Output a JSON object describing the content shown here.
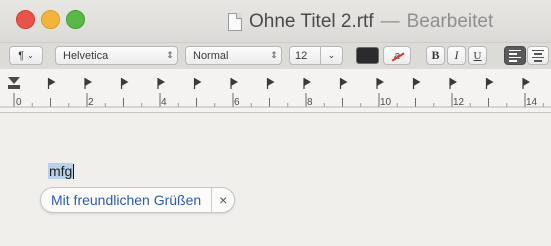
{
  "window": {
    "title": "Ohne Titel 2.rtf",
    "separator": "—",
    "status": "Bearbeitet"
  },
  "toolbar": {
    "paragraph_label": "¶",
    "font": "Helvetica",
    "style": "Normal",
    "size": "12",
    "text_color": "#2a2a2a",
    "highlight_label": "a",
    "bold_label": "B",
    "italic_label": "I",
    "underline_label": "U"
  },
  "ruler": {
    "labels": [
      "0",
      "2",
      "4",
      "6",
      "8",
      "10",
      "12",
      "14"
    ]
  },
  "document": {
    "typed_text": "mfg"
  },
  "autocorrect": {
    "suggestion": "Mit freundlichen Grüßen",
    "close_label": "×"
  }
}
